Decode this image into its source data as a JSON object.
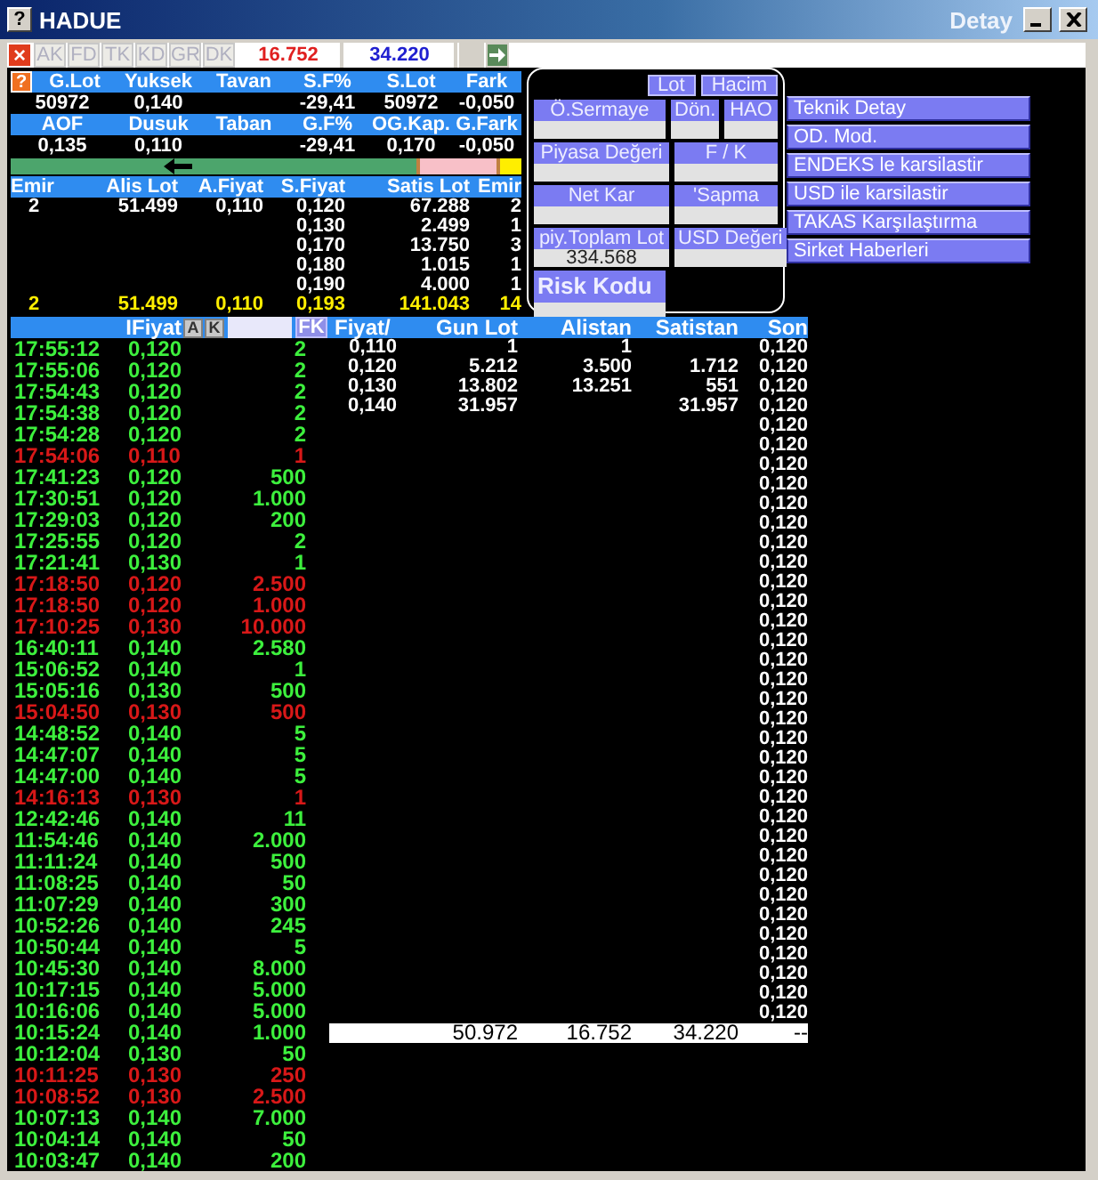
{
  "window": {
    "title": "HADUE",
    "subtitle": "Detay",
    "help": "?"
  },
  "toolbar": {
    "close": "×",
    "buttons": [
      {
        "label": "AK",
        "disabled": true
      },
      {
        "label": "FD",
        "disabled": true
      },
      {
        "label": "TK",
        "disabled": true
      },
      {
        "label": "KD",
        "disabled": true
      },
      {
        "label": "GR",
        "disabled": true
      },
      {
        "label": "DK",
        "disabled": true
      }
    ],
    "sell_total": "16.752",
    "buy_total": "34.220"
  },
  "summary": {
    "help": "?",
    "rows": [
      [
        {
          "header": "G.Lot",
          "value": "50972"
        },
        {
          "header": "Yuksek",
          "value": "0,140"
        },
        {
          "header": "Tavan"
        },
        {
          "header": "S.F%",
          "value": "-29,41"
        },
        {
          "header": "S.Lot",
          "value": "50972"
        },
        {
          "header": "Fark",
          "value": "-0,050"
        }
      ],
      [
        {
          "header": "AOF",
          "value": "0,135"
        },
        {
          "header": "Dusuk",
          "value": "0,110"
        },
        {
          "header": "Taban"
        },
        {
          "header": "G.F%",
          "value": "-29,41"
        },
        {
          "header": "OG.Kap.",
          "value": "0,170"
        },
        {
          "header": "G.Fark",
          "value": "-0,050"
        }
      ]
    ]
  },
  "bar": {
    "buy": {
      "level": 0.8
    },
    "sell": {
      "level": 0.05
    }
  },
  "order_book": {
    "columns": [
      "Emir",
      "Alis Lot",
      "A.Fiyat",
      "S.Fiyat",
      "Satis Lot",
      "Emir"
    ],
    "rows": [
      [
        "2",
        "51.499",
        "0,110",
        "0,120",
        "67.288",
        "2"
      ],
      [
        null,
        null,
        null,
        "0,130",
        "2.499",
        "1"
      ],
      [
        null,
        null,
        null,
        "0,170",
        "13.750",
        "3"
      ],
      [
        null,
        null,
        null,
        "0,180",
        "1.015",
        "1"
      ],
      [
        null,
        null,
        null,
        "0,190",
        "4.000",
        "1"
      ]
    ],
    "total": [
      "2",
      "51.499",
      "0,110",
      "0,193",
      "141.043",
      "14"
    ]
  },
  "detail": {
    "tabs": [
      "Lot",
      "Hacim"
    ],
    "rows": [
      [
        {
          "label": "Ö.Sermaye"
        },
        {
          "label": "Dön."
        },
        {
          "label": "HAO"
        }
      ],
      [
        {
          "label": "Piyasa Değeri"
        },
        {
          "label": "F / K"
        }
      ],
      [
        {
          "label": "Net Kar"
        },
        {
          "label": "'Sapma"
        }
      ],
      [
        {
          "label": "piy.Toplam Lot",
          "value": "334.568"
        },
        {
          "label": "USD Değeri"
        }
      ],
      [
        {
          "label": "Risk Kodu",
          "kind": "big"
        }
      ]
    ]
  },
  "actions": [
    "Teknik Detay",
    "OD. Mod.",
    "ENDEKS le karsilastir",
    "USD ile karsilastir",
    "TAKAS Karşılaştırma",
    "Sirket Haberleri"
  ],
  "trades": {
    "header": "IFiyat",
    "buttons": [
      "A",
      "K"
    ],
    "fk": "FK",
    "rows": [
      {
        "time": "17:55:12",
        "price": "0,120",
        "lot": "2",
        "kind": "up"
      },
      {
        "time": "17:55:06",
        "price": "0,120",
        "lot": "2",
        "kind": "up"
      },
      {
        "time": "17:54:43",
        "price": "0,120",
        "lot": "2",
        "kind": "up"
      },
      {
        "time": "17:54:38",
        "price": "0,120",
        "lot": "2",
        "kind": "up"
      },
      {
        "time": "17:54:28",
        "price": "0,120",
        "lot": "2",
        "kind": "up"
      },
      {
        "time": "17:54:06",
        "price": "0,110",
        "lot": "1",
        "kind": "down"
      },
      {
        "time": "17:41:23",
        "price": "0,120",
        "lot": "500",
        "kind": "up"
      },
      {
        "time": "17:30:51",
        "price": "0,120",
        "lot": "1.000",
        "kind": "up"
      },
      {
        "time": "17:29:03",
        "price": "0,120",
        "lot": "200",
        "kind": "up"
      },
      {
        "time": "17:25:55",
        "price": "0,120",
        "lot": "2",
        "kind": "up"
      },
      {
        "time": "17:21:41",
        "price": "0,130",
        "lot": "1",
        "kind": "up"
      },
      {
        "time": "17:18:50",
        "price": "0,120",
        "lot": "2.500",
        "kind": "down"
      },
      {
        "time": "17:18:50",
        "price": "0,120",
        "lot": "1.000",
        "kind": "down"
      },
      {
        "time": "17:10:25",
        "price": "0,130",
        "lot": "10.000",
        "kind": "down"
      },
      {
        "time": "16:40:11",
        "price": "0,140",
        "lot": "2.580",
        "kind": "up"
      },
      {
        "time": "15:06:52",
        "price": "0,140",
        "lot": "1",
        "kind": "up"
      },
      {
        "time": "15:05:16",
        "price": "0,130",
        "lot": "500",
        "kind": "up"
      },
      {
        "time": "15:04:50",
        "price": "0,130",
        "lot": "500",
        "kind": "down"
      },
      {
        "time": "14:48:52",
        "price": "0,140",
        "lot": "5",
        "kind": "up"
      },
      {
        "time": "14:47:07",
        "price": "0,140",
        "lot": "5",
        "kind": "up"
      },
      {
        "time": "14:47:00",
        "price": "0,140",
        "lot": "5",
        "kind": "up"
      },
      {
        "time": "14:16:13",
        "price": "0,130",
        "lot": "1",
        "kind": "down"
      },
      {
        "time": "12:42:46",
        "price": "0,140",
        "lot": "11",
        "kind": "up"
      },
      {
        "time": "11:54:46",
        "price": "0,140",
        "lot": "2.000",
        "kind": "up"
      },
      {
        "time": "11:11:24",
        "price": "0,140",
        "lot": "500",
        "kind": "up"
      },
      {
        "time": "11:08:25",
        "price": "0,140",
        "lot": "50",
        "kind": "up"
      },
      {
        "time": "11:07:29",
        "price": "0,140",
        "lot": "300",
        "kind": "up"
      },
      {
        "time": "10:52:26",
        "price": "0,140",
        "lot": "245",
        "kind": "up"
      },
      {
        "time": "10:50:44",
        "price": "0,140",
        "lot": "5",
        "kind": "up"
      },
      {
        "time": "10:45:30",
        "price": "0,140",
        "lot": "8.000",
        "kind": "up"
      },
      {
        "time": "10:17:15",
        "price": "0,140",
        "lot": "5.000",
        "kind": "up"
      },
      {
        "time": "10:16:06",
        "price": "0,140",
        "lot": "5.000",
        "kind": "up"
      },
      {
        "time": "10:15:24",
        "price": "0,140",
        "lot": "1.000",
        "kind": "up"
      },
      {
        "time": "10:12:04",
        "price": "0,130",
        "lot": "50",
        "kind": "up"
      },
      {
        "time": "10:11:25",
        "price": "0,130",
        "lot": "250",
        "kind": "down"
      },
      {
        "time": "10:08:52",
        "price": "0,130",
        "lot": "2.500",
        "kind": "down"
      },
      {
        "time": "10:07:13",
        "price": "0,140",
        "lot": "7.000",
        "kind": "up"
      },
      {
        "time": "10:04:14",
        "price": "0,140",
        "lot": "50",
        "kind": "up"
      },
      {
        "time": "10:03:47",
        "price": "0,140",
        "lot": "200",
        "kind": "up"
      }
    ]
  },
  "price_table": {
    "columns": [
      "Fiyat/",
      "Gun Lot",
      "Alistan",
      "Satistan",
      "Son"
    ],
    "rows": [
      [
        "0,110",
        "1",
        "1",
        null
      ],
      [
        "0,120",
        "5.212",
        "3.500",
        "1.712"
      ],
      [
        "0,130",
        "13.802",
        "13.251",
        "551"
      ],
      [
        "0,140",
        "31.957",
        null,
        "31.957"
      ]
    ],
    "son": [
      "0,120",
      "0,120",
      "0,120",
      "0,120",
      "0,120",
      "0,120",
      "0,120",
      "0,120",
      "0,120",
      "0,120",
      "0,120",
      "0,120",
      "0,120",
      "0,120",
      "0,120",
      "0,120",
      "0,120",
      "0,120",
      "0,120",
      "0,120",
      "0,120",
      "0,120",
      "0,120",
      "0,120",
      "0,120",
      "0,120",
      "0,120",
      "0,120",
      "0,120",
      "0,120",
      "0,120",
      "0,120",
      "0,120",
      "0,120",
      "0,120"
    ],
    "total": {
      "gun_lot": "50.972",
      "alistan": "16.752",
      "satistan": "34.220",
      "son": "--"
    }
  }
}
